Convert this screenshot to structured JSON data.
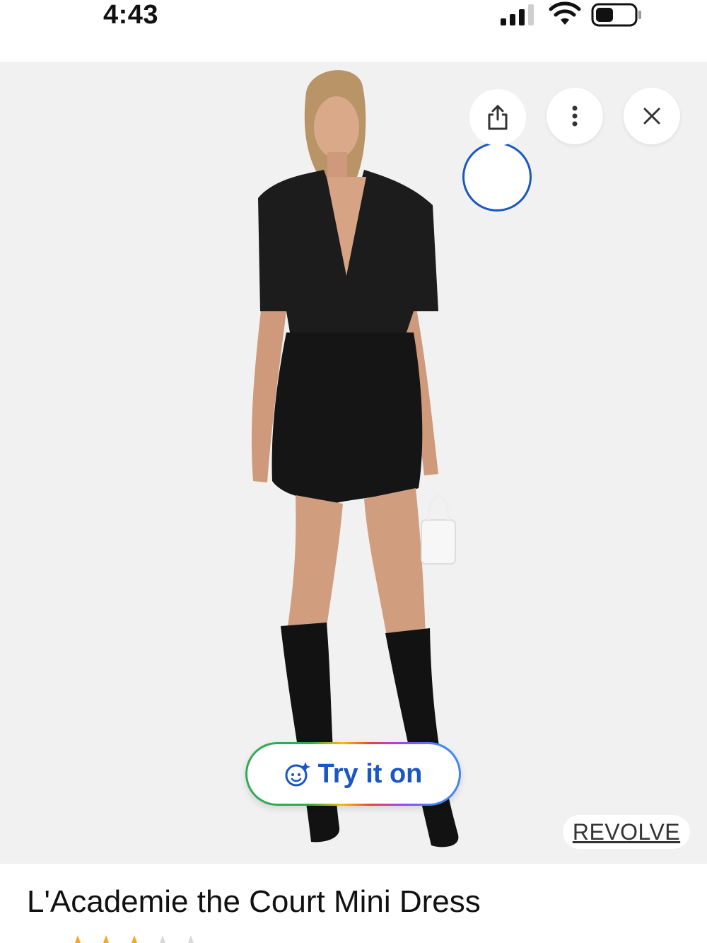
{
  "status_bar": {
    "time": "4:43"
  },
  "icons": {
    "signal": "cellular-signal-icon",
    "wifi": "wifi-icon",
    "battery": "battery-icon",
    "share": "share-icon",
    "more": "more-vertical-icon",
    "close": "close-icon",
    "try_on": "try-on-sparkle-icon",
    "stars": "star-rating-icon"
  },
  "actions": {
    "try_on_label": "Try it on"
  },
  "source": {
    "label": "REVOLVE"
  },
  "product": {
    "title": "L'Academie the Court Mini Dress"
  },
  "colors": {
    "accent": "#1a56c4",
    "image_background": "#f2f1f2",
    "star": "#f5a623"
  }
}
